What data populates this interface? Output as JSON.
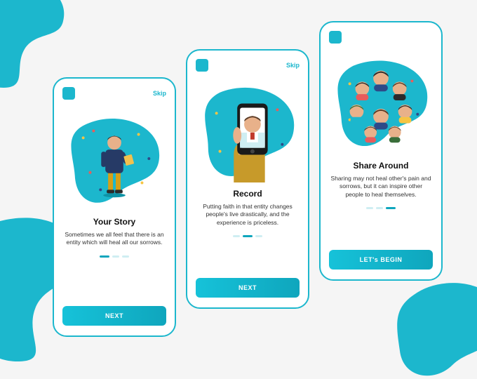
{
  "colors": {
    "accent": "#1cb7cd"
  },
  "common": {
    "skip": "Skip"
  },
  "screens": {
    "s1": {
      "title": "Your Story",
      "desc": "Sometimes we all feel that there is an entity which will heal all our sorrows.",
      "cta": "NEXT"
    },
    "s2": {
      "title": "Record",
      "desc": "Putting faith in that entity changes people's live drastically, and the experience is priceless.",
      "cta": "NEXT"
    },
    "s3": {
      "title": "Share Around",
      "desc": "Sharing may not heal other's pain and sorrows, but it can inspire other people to heal themselves.",
      "cta": "LET's BEGIN"
    }
  }
}
